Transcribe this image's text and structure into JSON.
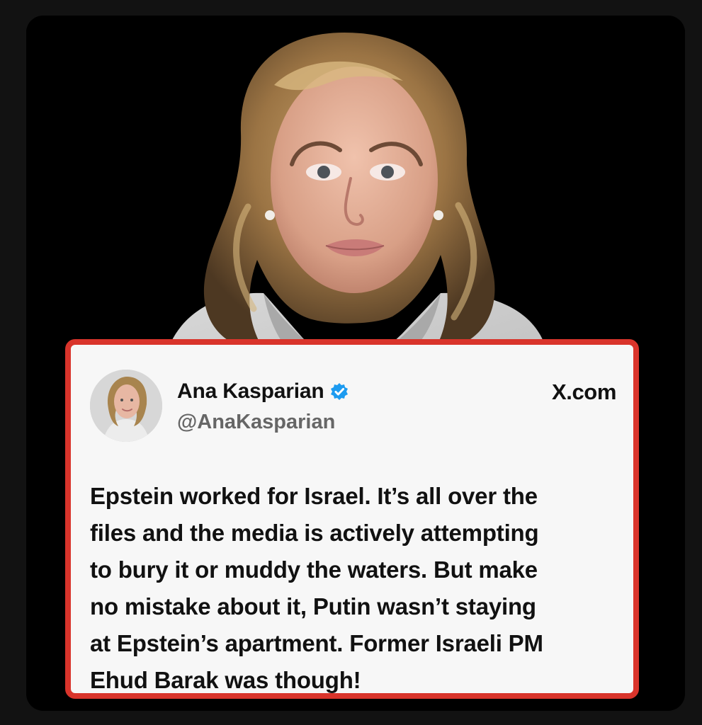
{
  "tweet": {
    "author_name": "Ana Kasparian",
    "handle": "@AnaKasparian",
    "source": "X.com",
    "verified_icon": "verified-badge-icon",
    "text": "Epstein worked for Israel. It’s all over the\nfiles and the media is actively attempting\nto bury it or muddy the waters. But make\nno mistake about it, Putin wasn’t staying\nat Epstein’s apartment. Former Israeli PM\nEhud Barak was though!"
  },
  "colors": {
    "background": "#121212",
    "card_border": "#d9342b",
    "card_background": "#f7f7f7",
    "verified_blue": "#1d9bf0",
    "text_primary": "#111111",
    "text_secondary": "#666666"
  }
}
